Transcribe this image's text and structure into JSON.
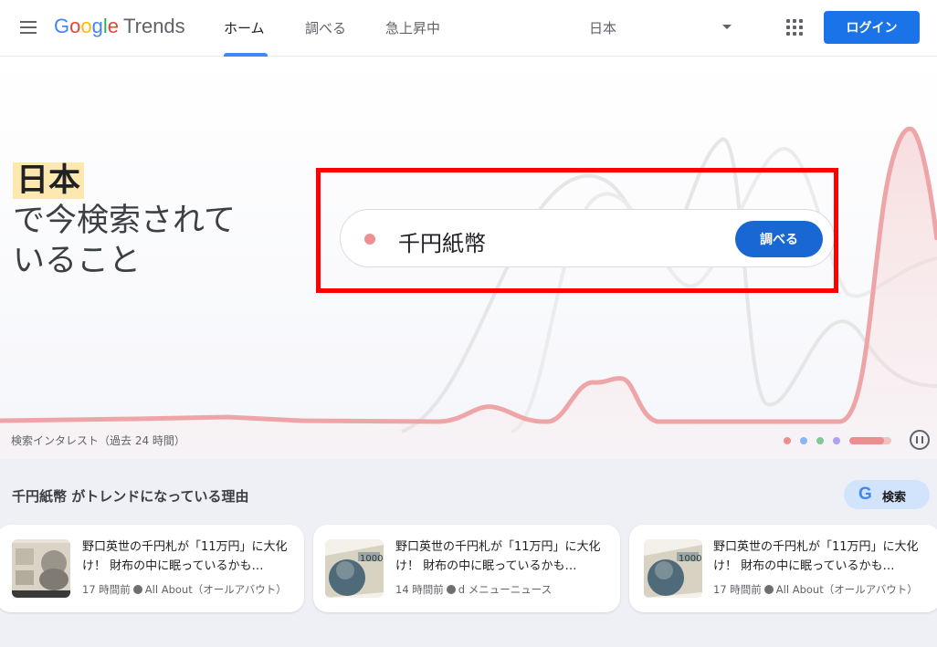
{
  "header": {
    "logo_google": "Google",
    "logo_trends": "Trends",
    "tabs": [
      {
        "label": "ホーム",
        "active": true
      },
      {
        "label": "調べる",
        "active": false
      },
      {
        "label": "急上昇中",
        "active": false
      }
    ],
    "region": "日本",
    "login_label": "ログイン",
    "icons": [
      "menu-icon",
      "apps-icon",
      "caret-icon"
    ]
  },
  "hero": {
    "title_highlight": "日本",
    "title_line2": "で今検索されて",
    "title_line3": "いること",
    "search_term": "千円紙幣",
    "explore_label": "調べる",
    "interest_label": "検索インタレスト（過去 24 時間）",
    "carousel_dot_colors": [
      "#ec8d8f",
      "#8ab4f8",
      "#81c995",
      "#aea3f0"
    ],
    "accent_color": "#ec8d8f"
  },
  "trend": {
    "heading": "千円紙幣 がトレンドになっている理由",
    "search_button_g": "G",
    "search_button_label": "検索",
    "articles": [
      {
        "title": "野口英世の千円札が「11万円」に大化け！ 財布の中に眠っているかも…",
        "time": "17 時間前",
        "source": "All About（オールアバウト）"
      },
      {
        "title": "野口英世の千円札が「11万円」に大化け！ 財布の中に眠っているかも…",
        "time": "14 時間前",
        "source": "d メニューニュース"
      },
      {
        "title": "野口英世の千円札が「11万円」に大化け！ 財布の中に眠っているかも…",
        "time": "17 時間前",
        "source": "All About（オールアバウト）"
      }
    ]
  },
  "colors": {
    "primary_blue": "#1a73e8",
    "highlight_red": "#ff0000"
  }
}
